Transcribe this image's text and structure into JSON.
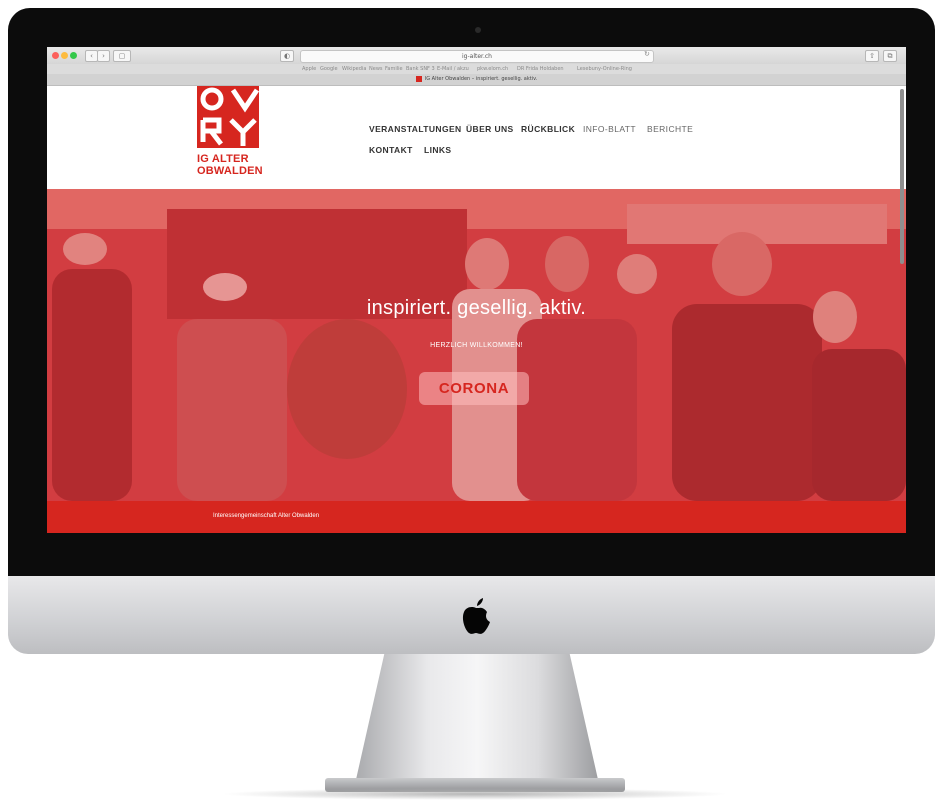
{
  "browser": {
    "url": "ig-alter.ch",
    "tab_title": "IG Alter Obwalden – inspiriert. gesellig. aktiv.",
    "favorites": [
      "Apple",
      "Google",
      "Wikipedia",
      "News",
      "Familie",
      "Bank SNF 3",
      "E-Mail / akzu",
      "pkw.elom.ch",
      "DR Frida Holdaben",
      "Lesebuny-Online-Ring"
    ]
  },
  "site": {
    "logo": {
      "line1": "IG ALTER",
      "line2": "OBWALDEN"
    },
    "nav": [
      "VERANSTALTUNGEN",
      "ÜBER UNS",
      "RÜCKBLICK",
      "INFO-BLATT",
      "BERICHTE",
      "KONTAKT",
      "LINKS"
    ]
  },
  "hero": {
    "title": "inspiriert. gesellig. aktiv.",
    "subtitle": "HERZLICH WILLKOMMEN!",
    "button": "CORONA"
  },
  "footer": {
    "text": "Interessengemeinschaft Alter Obwalden"
  },
  "colors": {
    "accent": "#d6261f",
    "hero_tint": "#d34b4e"
  },
  "icons": [
    "apple-logo-icon",
    "lock-icon",
    "reload-icon",
    "share-icon",
    "tabs-icon"
  ]
}
